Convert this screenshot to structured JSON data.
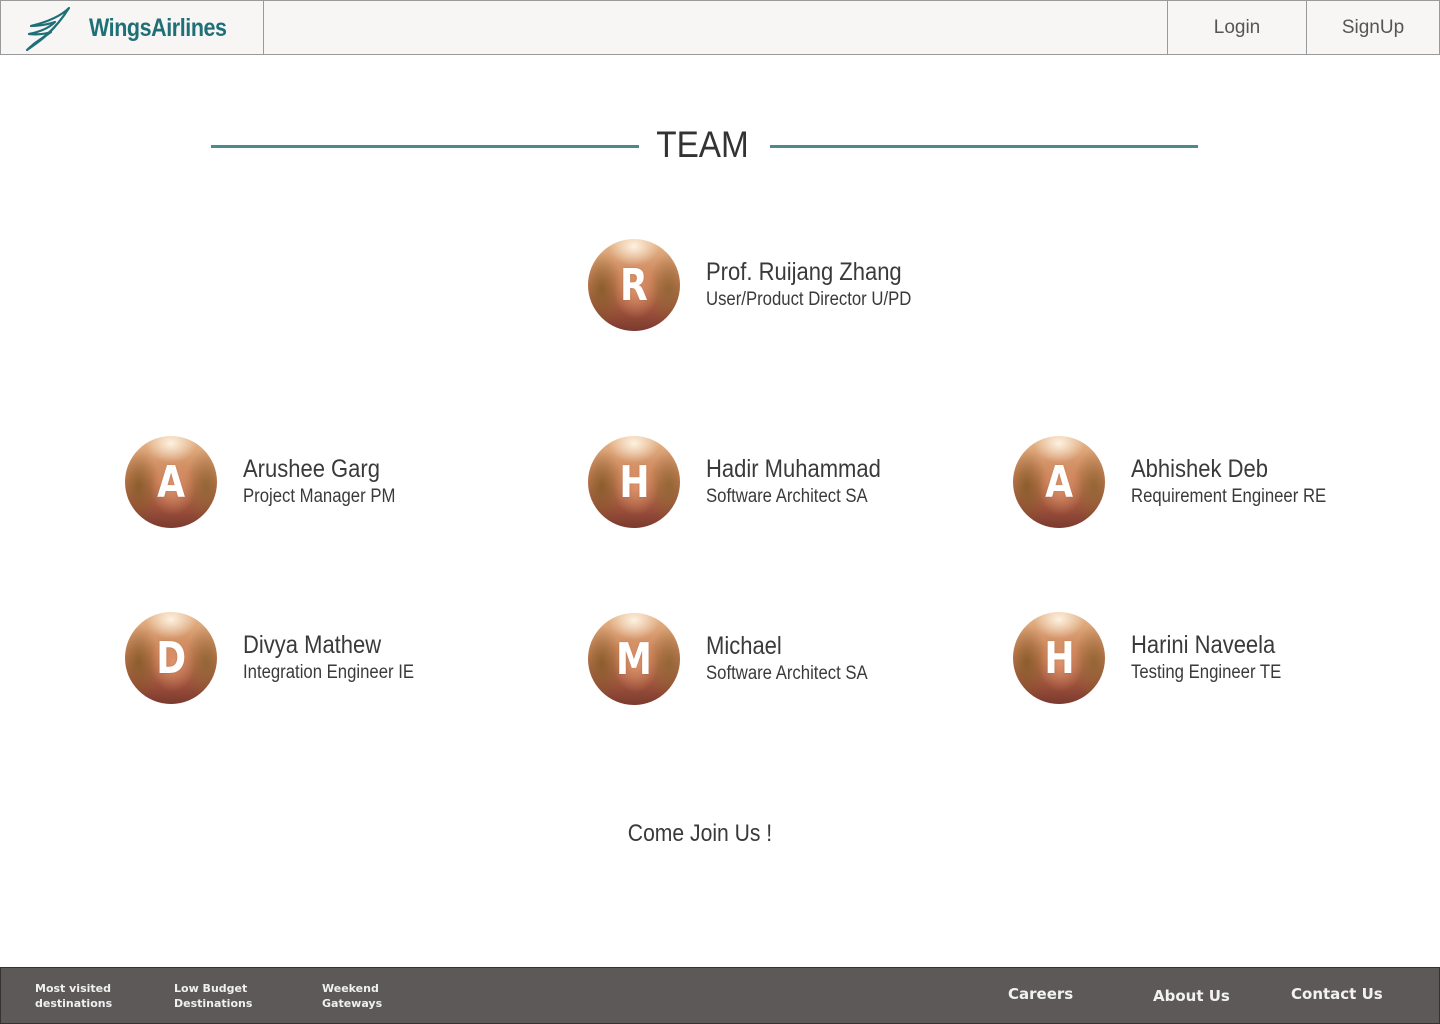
{
  "header": {
    "brand": "WingsAirlines",
    "login_label": "Login",
    "signup_label": "SignUp"
  },
  "team": {
    "title": "TEAM",
    "members": [
      {
        "initial": "R",
        "name": "Prof. Ruijang Zhang",
        "role": "User/Product Director U/PD"
      },
      {
        "initial": "A",
        "name": "Arushee Garg",
        "role": "Project Manager PM"
      },
      {
        "initial": "H",
        "name": "Hadir Muhammad",
        "role": "Software Architect SA"
      },
      {
        "initial": "A",
        "name": "Abhishek Deb",
        "role": "Requirement Engineer RE"
      },
      {
        "initial": "D",
        "name": "Divya Mathew",
        "role": "Integration Engineer IE"
      },
      {
        "initial": "M",
        "name": "Michael",
        "role": "Software Architect SA"
      },
      {
        "initial": "H",
        "name": "Harini Naveela",
        "role": "Testing Engineer TE"
      }
    ],
    "cta": "Come Join Us !"
  },
  "footer": {
    "links_left": [
      {
        "line1": "Most visited",
        "line2": "destinations"
      },
      {
        "line1": "Low Budget",
        "line2": "Destinations"
      },
      {
        "line1": "Weekend",
        "line2": "Gateways"
      }
    ],
    "careers": "Careers",
    "about": "About Us",
    "contact": "Contact Us"
  },
  "colors": {
    "brand": "#1f6f76",
    "accent_line": "#4b8a8d",
    "header_bg": "#f7f6f5",
    "footer_bg": "#5d5959"
  },
  "icons": {
    "logo": "wing-logo-icon"
  }
}
